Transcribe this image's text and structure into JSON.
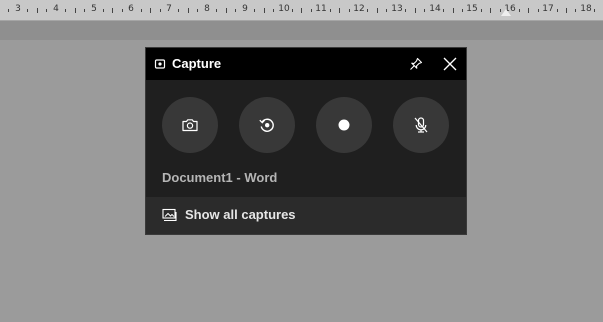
{
  "ruler": {
    "numbers": [
      "3",
      "4",
      "5",
      "6",
      "7",
      "8",
      "9",
      "10",
      "11",
      "12",
      "13",
      "14",
      "15",
      "16",
      "17",
      "18"
    ]
  },
  "capture": {
    "title": "Capture",
    "source_app": "Document1 - Word",
    "show_all_label": "Show all captures",
    "buttons": [
      "camera-icon",
      "record-last-icon",
      "record-icon",
      "mic-off-icon"
    ]
  }
}
